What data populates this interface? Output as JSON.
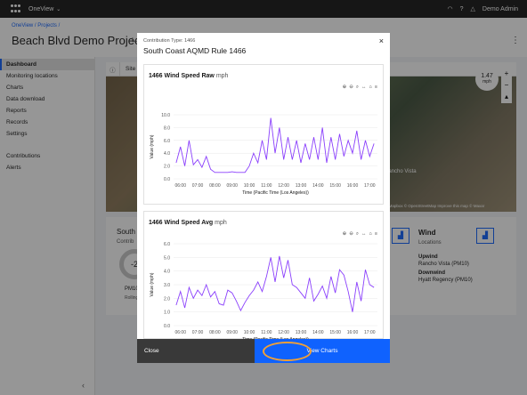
{
  "topbar": {
    "brand": "OneView",
    "user": "Demo Admin"
  },
  "header": {
    "breadcrumb": "OneView  /  Projects  /",
    "title": "Beach Blvd Demo Project",
    "subtitle_fragment": "Lo"
  },
  "sidebar": {
    "items": [
      "Dashboard",
      "Monitoring locations",
      "Charts",
      "Data download",
      "Reports",
      "Records",
      "Settings"
    ],
    "items2": [
      "Contributions",
      "Alerts"
    ]
  },
  "map": {
    "tab_label": "Site",
    "badge_value": "1.47",
    "badge_unit": "mph",
    "place": "Rancho Vista",
    "credit": "© Mapbox © OpenStreetMap Improve this map © Maxar"
  },
  "card": {
    "title": "South",
    "contrib": "Contrib",
    "gauge": "-2",
    "pm": "PM10",
    "rolling": "Rolling",
    "wind": {
      "title": "Wind",
      "locations": "Locations",
      "upwind_label": "Upwind",
      "upwind": "Rancho Vista (PM10)",
      "downwind_label": "Downwind",
      "downwind": "Hyatt Regency (PM10)"
    }
  },
  "modal": {
    "label": "Contribution Type: 1466",
    "title": "South Coast AQMD Rule 1466",
    "close_label": "Close",
    "view_label": "View Charts"
  },
  "colors": {
    "series": "#8a3ffc",
    "primary": "#0f62fe",
    "highlight": "#f1a036"
  },
  "chart_data": [
    {
      "type": "line",
      "title": "1466 Wind Speed Raw",
      "unit": "mph",
      "xlabel": "Time (Pacific Time (Los Angeles))",
      "ylabel": "Value (mph)",
      "ylim": [
        0,
        10
      ],
      "yticks": [
        "10.0",
        "8.0",
        "6.0",
        "4.0",
        "2.0",
        "0.0"
      ],
      "xticks": [
        "06:00",
        "07:00",
        "08:00",
        "09:00",
        "10:00",
        "11:00",
        "12:00",
        "13:00",
        "14:00",
        "15:00",
        "16:00",
        "17:00"
      ],
      "x": [
        5.75,
        6,
        6.25,
        6.5,
        6.75,
        7,
        7.25,
        7.5,
        7.75,
        8,
        8.25,
        8.5,
        8.75,
        9,
        9.25,
        9.5,
        9.75,
        10,
        10.25,
        10.5,
        10.75,
        11,
        11.25,
        11.5,
        11.75,
        12,
        12.25,
        12.5,
        12.75,
        13,
        13.25,
        13.5,
        13.75,
        14,
        14.25,
        14.5,
        14.75,
        15,
        15.25,
        15.5,
        15.75,
        16,
        16.25,
        16.5,
        16.75,
        17,
        17.25
      ],
      "series": [
        {
          "values": [
            2.5,
            5.0,
            2.0,
            6.0,
            2.2,
            3.0,
            1.8,
            3.5,
            1.5,
            1.0,
            1.0,
            1.0,
            1.0,
            1.1,
            1.0,
            1.0,
            1.0,
            2.0,
            4.0,
            2.5,
            6.0,
            3.0,
            9.5,
            4.0,
            8.0,
            3.0,
            6.5,
            3.0,
            6.0,
            2.5,
            5.5,
            3.0,
            6.5,
            3.0,
            8.0,
            2.5,
            6.5,
            3.0,
            7.0,
            3.5,
            6.0,
            4.0,
            7.5,
            3.0,
            6.0,
            3.5,
            5.5
          ]
        }
      ]
    },
    {
      "type": "line",
      "title": "1466 Wind Speed Avg",
      "unit": "mph",
      "xlabel": "Time (Pacific Time (Los Angeles))",
      "ylabel": "Value (mph)",
      "ylim": [
        0,
        6
      ],
      "yticks": [
        "6.0",
        "5.0",
        "4.0",
        "3.0",
        "2.0",
        "1.0",
        "0.0"
      ],
      "xticks": [
        "06:00",
        "07:00",
        "08:00",
        "09:00",
        "10:00",
        "11:00",
        "12:00",
        "13:00",
        "14:00",
        "15:00",
        "16:00",
        "17:00"
      ],
      "x": [
        5.75,
        6,
        6.25,
        6.5,
        6.75,
        7,
        7.25,
        7.5,
        7.75,
        8,
        8.25,
        8.5,
        8.75,
        9,
        9.25,
        9.5,
        9.75,
        10,
        10.25,
        10.5,
        10.75,
        11,
        11.25,
        11.5,
        11.75,
        12,
        12.25,
        12.5,
        12.75,
        13,
        13.25,
        13.5,
        13.75,
        14,
        14.25,
        14.5,
        14.75,
        15,
        15.25,
        15.5,
        15.75,
        16,
        16.25,
        16.5,
        16.75,
        17,
        17.25
      ],
      "series": [
        {
          "values": [
            1.5,
            2.5,
            1.3,
            2.8,
            2.0,
            2.6,
            2.2,
            3.0,
            2.1,
            2.5,
            1.6,
            1.5,
            2.6,
            2.4,
            1.8,
            1.1,
            1.7,
            2.2,
            2.6,
            3.2,
            2.5,
            3.6,
            5.0,
            3.2,
            5.1,
            3.5,
            4.8,
            3.0,
            2.8,
            2.4,
            2.0,
            3.5,
            1.8,
            2.3,
            2.9,
            2.0,
            3.6,
            2.4,
            4.1,
            3.7,
            2.5,
            1.0,
            3.2,
            1.8,
            4.1,
            3.0,
            2.8
          ]
        }
      ]
    }
  ]
}
